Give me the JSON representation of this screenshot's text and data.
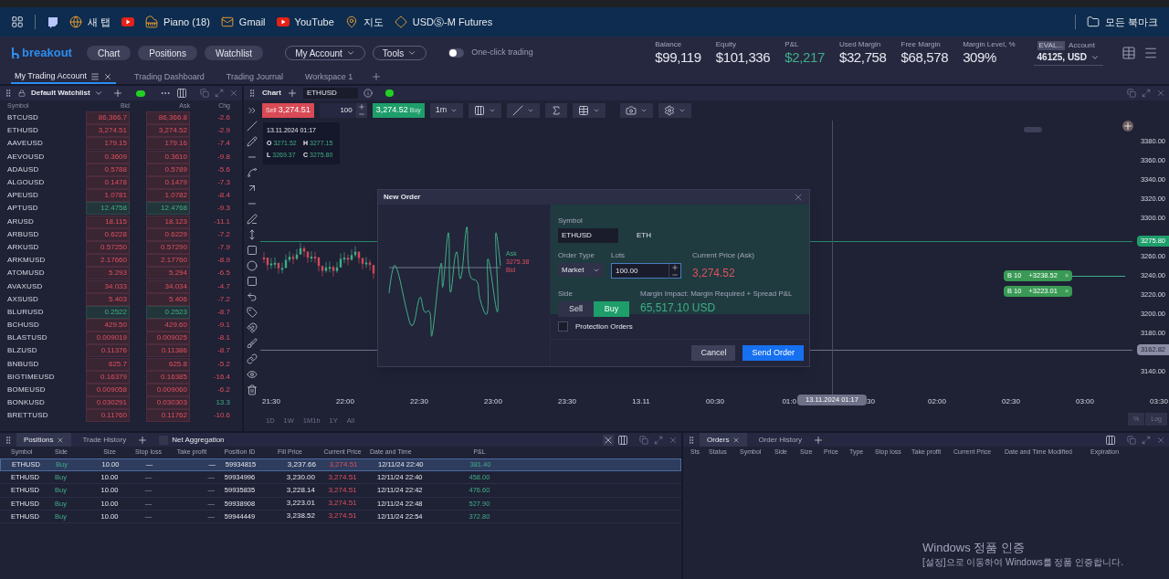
{
  "browser": {
    "bookmarks": [
      "새 탭",
      "Piano (18)",
      "Gmail",
      "YouTube",
      "지도",
      "USDⓈ-M Futures"
    ],
    "bookmarks_right": "모든 북마크"
  },
  "header": {
    "logo_text": "breakout",
    "nav_buttons": [
      "Chart",
      "Positions",
      "Watchlist"
    ],
    "menus": [
      "My Account",
      "Tools"
    ],
    "one_click": {
      "label": "One-click trading",
      "on": false
    },
    "stats": [
      {
        "label": "Balance",
        "value": "$99,119",
        "kind": "plain"
      },
      {
        "label": "Equity",
        "value": "$101,336",
        "kind": "plain"
      },
      {
        "label": "P&L",
        "value": "$2,217",
        "kind": "gain"
      },
      {
        "label": "Used Margin",
        "value": "$32,758",
        "kind": "plain"
      },
      {
        "label": "Free Margin",
        "value": "$68,578",
        "kind": "plain"
      },
      {
        "label": "Margin Level, %",
        "value": "309%",
        "kind": "plain"
      }
    ],
    "account": {
      "badge": "EVAL...",
      "label": "Account",
      "value": "46125, USD"
    }
  },
  "workspace_tabs": [
    {
      "label": "My Trading Account",
      "selected": true
    },
    {
      "label": "Trading Dashboard",
      "selected": false
    },
    {
      "label": "Trading Journal",
      "selected": false
    },
    {
      "label": "Workspace 1",
      "selected": false
    }
  ],
  "watchlist": {
    "title": "Default Watchlist",
    "columns": [
      "Symbol",
      "Bid",
      "Ask",
      "Chg"
    ],
    "rows": [
      {
        "symbol": "BTCUSD",
        "bid": "86,366.7",
        "ask": "86,366.8",
        "chg": "-2.6",
        "up": false,
        "chg_up": false
      },
      {
        "symbol": "ETHUSD",
        "bid": "3,274.51",
        "ask": "3,274.52",
        "chg": "-2.9",
        "up": false,
        "chg_up": false
      },
      {
        "symbol": "AAVEUSD",
        "bid": "179.15",
        "ask": "179.16",
        "chg": "-7.4",
        "up": false,
        "chg_up": false
      },
      {
        "symbol": "AEVOUSD",
        "bid": "0.3609",
        "ask": "0.3610",
        "chg": "-9.8",
        "up": false,
        "chg_up": false
      },
      {
        "symbol": "ADAUSD",
        "bid": "0.5788",
        "ask": "0.5789",
        "chg": "-5.6",
        "up": false,
        "chg_up": false
      },
      {
        "symbol": "ALGOUSD",
        "bid": "0.1478",
        "ask": "0.1479",
        "chg": "-7.3",
        "up": false,
        "chg_up": false
      },
      {
        "symbol": "APEUSD",
        "bid": "1.0781",
        "ask": "1.0782",
        "chg": "-8.4",
        "up": false,
        "chg_up": false
      },
      {
        "symbol": "APTUSD",
        "bid": "12.4758",
        "ask": "12.4768",
        "chg": "-9.3",
        "up": true,
        "chg_up": false
      },
      {
        "symbol": "ARUSD",
        "bid": "18.115",
        "ask": "18.123",
        "chg": "-11.1",
        "up": false,
        "chg_up": false
      },
      {
        "symbol": "ARBUSD",
        "bid": "0.6228",
        "ask": "0.6229",
        "chg": "-7.2",
        "up": false,
        "chg_up": false
      },
      {
        "symbol": "ARKUSD",
        "bid": "0.57250",
        "ask": "0.57290",
        "chg": "-7.9",
        "up": false,
        "chg_up": false
      },
      {
        "symbol": "ARKMUSD",
        "bid": "2.17660",
        "ask": "2.17760",
        "chg": "-8.9",
        "up": false,
        "chg_up": false
      },
      {
        "symbol": "ATOMUSD",
        "bid": "5.293",
        "ask": "5.294",
        "chg": "-6.5",
        "up": false,
        "chg_up": false
      },
      {
        "symbol": "AVAXUSD",
        "bid": "34.033",
        "ask": "34.034",
        "chg": "-4.7",
        "up": false,
        "chg_up": false
      },
      {
        "symbol": "AXSUSD",
        "bid": "5.403",
        "ask": "5.406",
        "chg": "-7.2",
        "up": false,
        "chg_up": false
      },
      {
        "symbol": "BLURUSD",
        "bid": "0.2522",
        "ask": "0.2523",
        "chg": "-8.7",
        "up": true,
        "chg_up": false
      },
      {
        "symbol": "BCHUSD",
        "bid": "429.50",
        "ask": "429.60",
        "chg": "-9.1",
        "up": false,
        "chg_up": false
      },
      {
        "symbol": "BLASTUSD",
        "bid": "0.009019",
        "ask": "0.009025",
        "chg": "-8.1",
        "up": false,
        "chg_up": false
      },
      {
        "symbol": "BLZUSD",
        "bid": "0.11376",
        "ask": "0.11386",
        "chg": "-8.7",
        "up": false,
        "chg_up": false
      },
      {
        "symbol": "BNBUSD",
        "bid": "625.7",
        "ask": "625.8",
        "chg": "-5.2",
        "up": false,
        "chg_up": false
      },
      {
        "symbol": "BIGTIMEUSD",
        "bid": "0.16379",
        "ask": "0.16385",
        "chg": "-16.4",
        "up": false,
        "chg_up": false
      },
      {
        "symbol": "BOMEUSD",
        "bid": "0.009058",
        "ask": "0.009060",
        "chg": "-6.2",
        "up": false,
        "chg_up": false
      },
      {
        "symbol": "BONKUSD",
        "bid": "0.030291",
        "ask": "0.030303",
        "chg": "13.3",
        "up": false,
        "chg_up": true
      },
      {
        "symbol": "BRETTUSD",
        "bid": "0.11760",
        "ask": "0.11762",
        "chg": "-10.6",
        "up": false,
        "chg_up": false
      }
    ]
  },
  "chart": {
    "tab": "Chart",
    "symbol": "ETHUSD",
    "sell_label": "Sell",
    "sell_price": "3,274.51",
    "lots": "100",
    "buy_price": "3,274.52",
    "buy_label": "Buy",
    "interval": "1m",
    "legend": {
      "date": "13.11.2024 01:17",
      "ohlc": [
        {
          "key": "O",
          "value": "3271.52"
        },
        {
          "key": "H",
          "value": "3277.15"
        },
        {
          "key": "L",
          "value": "3269.37"
        },
        {
          "key": "C",
          "value": "3275.80"
        }
      ]
    },
    "price_axis": [
      "3380.00",
      "3360.00",
      "3340.00",
      "3320.00",
      "3300.00",
      "3260.00",
      "3240.00",
      "3220.00",
      "3200.00",
      "3180.00",
      "3140.00"
    ],
    "price_tags": [
      {
        "value": "3275.80",
        "kind": "last"
      },
      {
        "value": "3162.82",
        "kind": "cursor"
      }
    ],
    "position_tags": [
      {
        "side": "B 10",
        "price": "+3238.52",
        "close": "×"
      },
      {
        "side": "B 10",
        "price": "+3223.01",
        "close": "×"
      }
    ],
    "time_axis": [
      "21:30",
      "22:00",
      "22:30",
      "23:00",
      "23:30",
      "13.11",
      "00:30",
      "01:0",
      "30",
      "02:00",
      "02:30",
      "03:00",
      "03:30"
    ],
    "crosshair_label": "13.11.2024 01:17",
    "ranges": [
      "1D",
      "1W",
      "1M",
      "1h",
      "1Y",
      "All"
    ],
    "scale_buttons": [
      "%",
      "Log"
    ]
  },
  "order_dialog": {
    "title": "New Order",
    "mini_chart": {
      "ask_label": "Ask",
      "price": "3275.38",
      "bid_label": "Bid"
    },
    "symbol_label": "Symbol",
    "symbol": "ETHUSD",
    "base": "ETH",
    "order_type_label": "Order Type",
    "order_type": "Market",
    "lots_label": "Lots",
    "lots": "100.00",
    "price_label": "Current Price (Ask)",
    "price": "3,274.52",
    "side_label": "Side",
    "sides": [
      {
        "label": "Sell",
        "selected": false
      },
      {
        "label": "Buy",
        "selected": true
      }
    ],
    "margin_label": "Margin Impact: Margin Required + Spread P&L",
    "margin_value": "65,517.10 USD",
    "protection": {
      "label": "Protection Orders",
      "checked": false
    },
    "cancel": "Cancel",
    "submit": "Send Order"
  },
  "positions": {
    "tabs": [
      {
        "label": "Positions",
        "selected": true
      },
      {
        "label": "Trade History",
        "selected": false
      }
    ],
    "net_aggregation": {
      "label": "Net Aggregation",
      "checked": false
    },
    "columns": [
      "Symbol",
      "Side",
      "Size",
      "Stop loss",
      "Take profit",
      "Position ID",
      "Fill Price",
      "Current Price",
      "Date and Time",
      "P&L"
    ],
    "rows": [
      {
        "symbol": "ETHUSD",
        "side": "Buy",
        "size": "10.00",
        "stop_loss": "—",
        "take_profit": "—",
        "id": "59934815",
        "fill": "3,237.66",
        "current": "3,274.51",
        "time": "12/11/24 22:40",
        "pnl": "381.40",
        "selected": true
      },
      {
        "symbol": "ETHUSD",
        "side": "Buy",
        "size": "10.00",
        "stop_loss": "—",
        "take_profit": "—",
        "id": "59934996",
        "fill": "3,230.00",
        "current": "3,274.51",
        "time": "12/11/24 22:40",
        "pnl": "458.00",
        "selected": false
      },
      {
        "symbol": "ETHUSD",
        "side": "Buy",
        "size": "10.00",
        "stop_loss": "—",
        "take_profit": "—",
        "id": "59935835",
        "fill": "3,228.14",
        "current": "3,274.51",
        "time": "12/11/24 22:42",
        "pnl": "476.60",
        "selected": false
      },
      {
        "symbol": "ETHUSD",
        "side": "Buy",
        "size": "10.00",
        "stop_loss": "—",
        "take_profit": "—",
        "id": "59938908",
        "fill": "3,223.01",
        "current": "3,274.51",
        "time": "12/11/24 22:48",
        "pnl": "527.90",
        "selected": false
      },
      {
        "symbol": "ETHUSD",
        "side": "Buy",
        "size": "10.00",
        "stop_loss": "—",
        "take_profit": "—",
        "id": "59944449",
        "fill": "3,238.52",
        "current": "3,274.51",
        "time": "12/11/24 22:54",
        "pnl": "372.80",
        "selected": false
      }
    ]
  },
  "orders": {
    "tabs": [
      {
        "label": "Orders",
        "selected": true
      },
      {
        "label": "Order History",
        "selected": false
      }
    ],
    "columns": [
      "Sts",
      "Status",
      "Symbol",
      "Side",
      "Size",
      "Price",
      "Type",
      "Stop loss",
      "Take profit",
      "Current Price",
      "Date and Time Modified",
      "Expiration"
    ]
  },
  "os_notice": {
    "title": "Windows 정품 인증",
    "text": "[설정]으로 이동하여 Windows를 정품 인증합니다."
  }
}
